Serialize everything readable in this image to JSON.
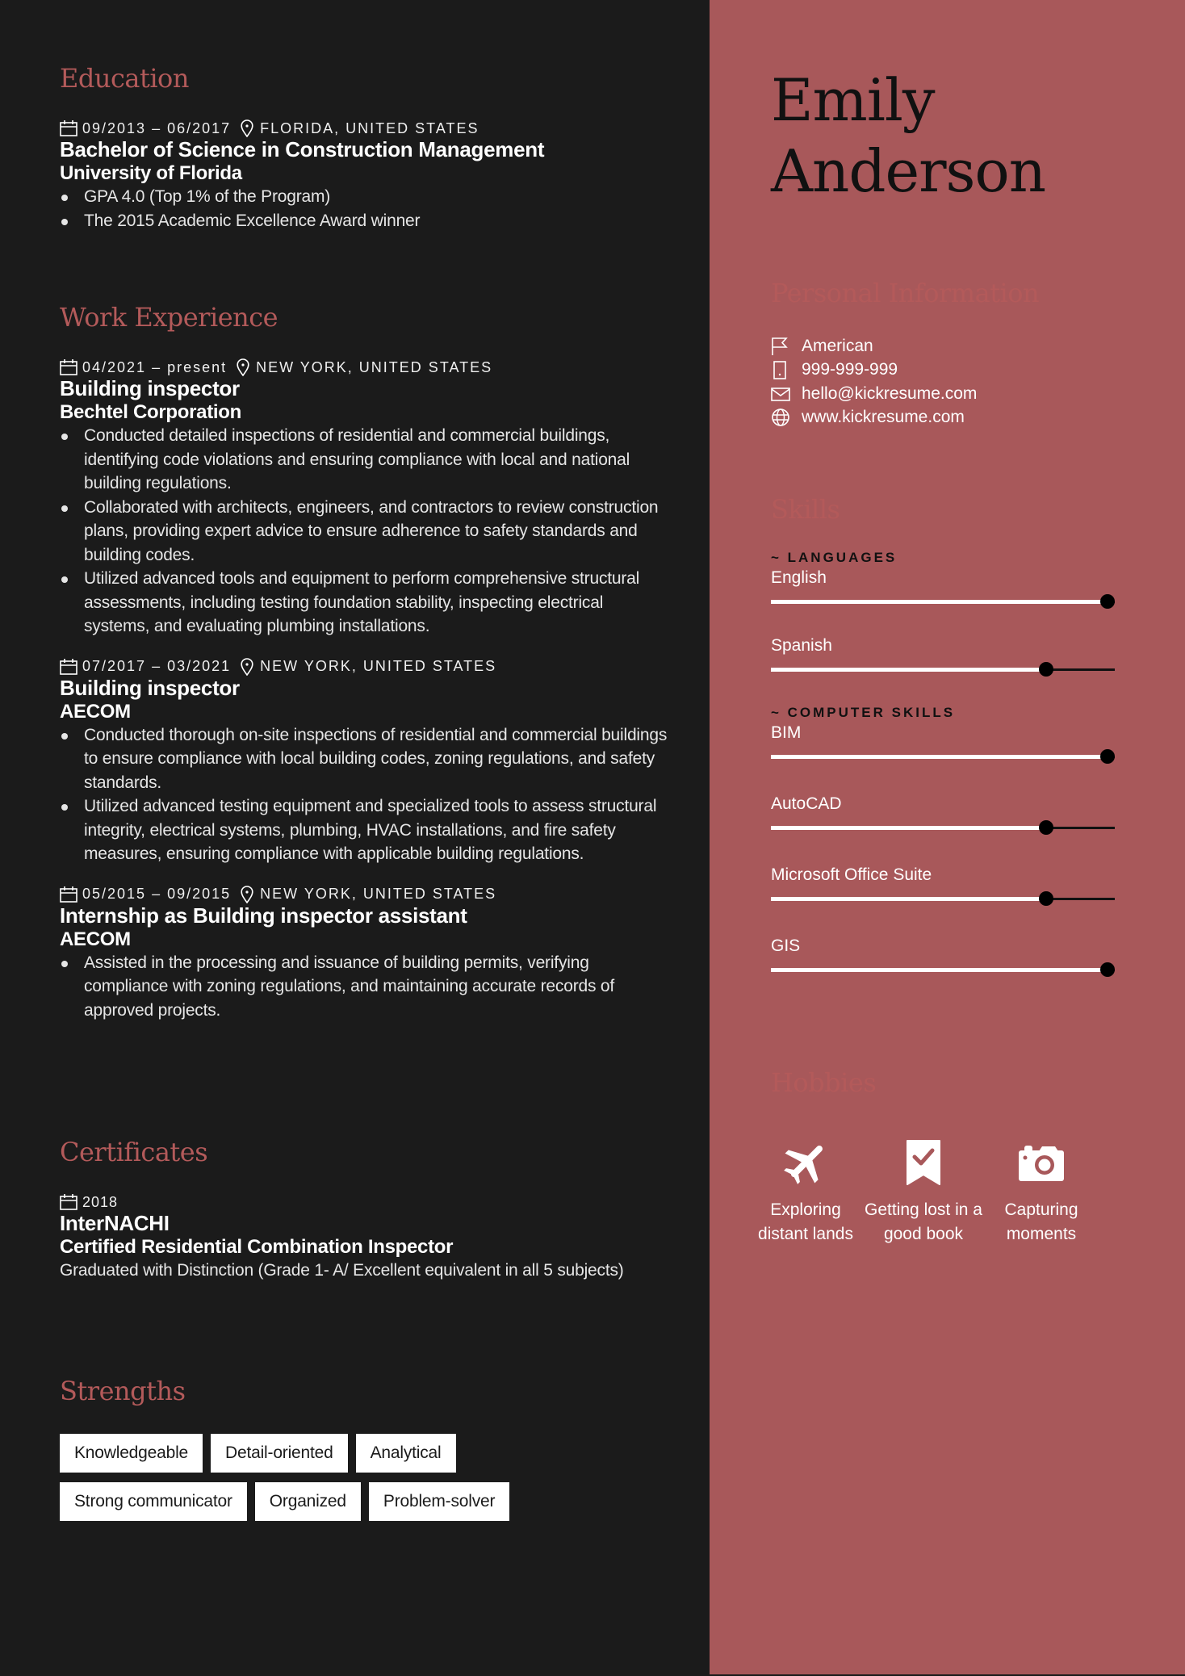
{
  "colors": {
    "left_bg": "#1b1b1b",
    "right_bg": "#a8585a",
    "accent": "#b35a5a",
    "text_dark": "#111111",
    "text_light": "#ffffff"
  },
  "profile": {
    "first_name": "Emily",
    "last_name": "Anderson"
  },
  "education": {
    "title": "Education",
    "entries": [
      {
        "dates": "09/2013 – 06/2017",
        "location": "FLORIDA, UNITED STATES",
        "degree": "Bachelor of Science in Construction Management",
        "school": "University of Florida",
        "bullets": [
          "GPA 4.0 (Top 1% of the Program)",
          "The 2015 Academic Excellence Award winner"
        ]
      }
    ]
  },
  "work": {
    "title": "Work Experience",
    "entries": [
      {
        "dates": "04/2021 – present",
        "location": "NEW YORK, UNITED STATES",
        "role": "Building inspector",
        "company": "Bechtel Corporation",
        "bullets": [
          "Conducted detailed inspections of residential and commercial buildings, identifying code violations and ensuring compliance with local and national building regulations.",
          "Collaborated with architects, engineers, and contractors to review construction plans, providing expert advice to ensure adherence to safety standards and building codes.",
          "Utilized advanced tools and equipment to perform comprehensive structural assessments, including testing foundation stability, inspecting electrical systems, and evaluating plumbing installations."
        ]
      },
      {
        "dates": "07/2017 – 03/2021",
        "location": "NEW YORK, UNITED STATES",
        "role": "Building inspector",
        "company": "AECOM",
        "bullets": [
          "Conducted thorough on-site inspections of residential and commercial buildings to ensure compliance with local building codes, zoning regulations, and safety standards.",
          "Utilized advanced testing equipment and specialized tools to assess structural integrity, electrical systems, plumbing, HVAC installations, and fire safety measures, ensuring compliance with applicable building regulations."
        ]
      },
      {
        "dates": "05/2015 – 09/2015",
        "location": "NEW YORK, UNITED STATES",
        "role": "Internship as Building inspector assistant",
        "company": "AECOM",
        "bullets": [
          "Assisted in the processing and issuance of building permits, verifying compliance with zoning regulations, and maintaining accurate records of approved projects."
        ]
      }
    ]
  },
  "certificates": {
    "title": "Certificates",
    "entries": [
      {
        "date": "2018",
        "issuer": "InterNACHI",
        "name": "Certified Residential Combination Inspector",
        "description": "Graduated with Distinction (Grade 1- A/ Excellent  equivalent in all 5 subjects)"
      }
    ]
  },
  "strengths": {
    "title": "Strengths",
    "items": [
      "Knowledgeable",
      "Detail-oriented",
      "Analytical",
      "Strong communicator",
      "Organized",
      "Problem-solver"
    ]
  },
  "personal_info": {
    "title": "Personal Information",
    "items": [
      {
        "icon": "flag-icon",
        "value": "American"
      },
      {
        "icon": "phone-icon",
        "value": "999-999-999"
      },
      {
        "icon": "mail-icon",
        "value": "hello@kickresume.com"
      },
      {
        "icon": "globe-icon",
        "value": "www.kickresume.com"
      }
    ]
  },
  "skills": {
    "title": "Skills",
    "categories": [
      {
        "label": "~ LANGUAGES",
        "items": [
          {
            "name": "English",
            "level": 1.0
          },
          {
            "name": "Spanish",
            "level": 0.8
          }
        ]
      },
      {
        "label": "~ COMPUTER SKILLS",
        "items": [
          {
            "name": "BIM",
            "level": 1.0
          },
          {
            "name": "AutoCAD",
            "level": 0.8
          },
          {
            "name": "Microsoft Office Suite",
            "level": 0.8
          },
          {
            "name": "GIS",
            "level": 1.0
          }
        ]
      }
    ]
  },
  "hobbies": {
    "title": "Hobbies",
    "items": [
      {
        "icon": "airplane-icon",
        "label": "Exploring distant lands"
      },
      {
        "icon": "bookmark-check-icon",
        "label": "Getting lost in a good book"
      },
      {
        "icon": "camera-icon",
        "label": "Capturing moments"
      }
    ]
  }
}
